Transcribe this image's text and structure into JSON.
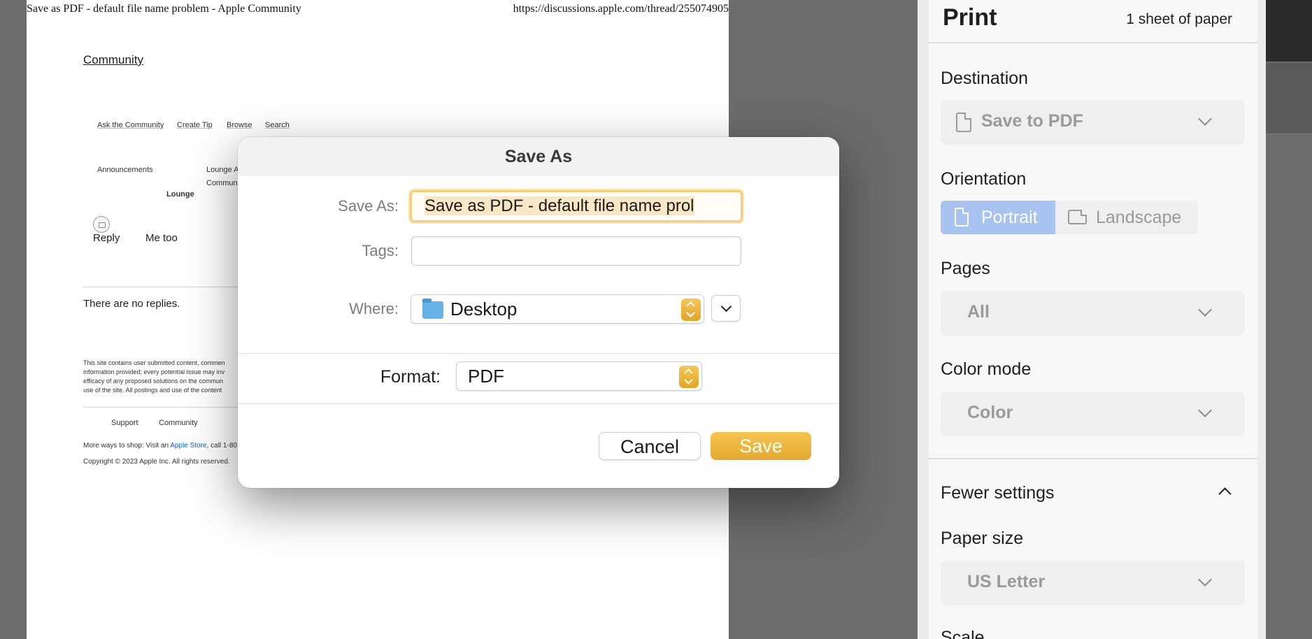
{
  "preview": {
    "header_title": "Save as PDF - default file name problem - Apple Community",
    "header_url": "https://discussions.apple.com/thread/255074905",
    "community_link": "Community",
    "nav": [
      "Ask the Community",
      "Create Tip",
      "Browse",
      "Search"
    ],
    "breadcrumb_announcements": "Announcements",
    "breadcrumb_lounge_a": "Lounge A",
    "breadcrumb_communi": "Communi",
    "breadcrumb_lounge": "Lounge",
    "reply_label": "Reply",
    "me_too_label": "Me too",
    "no_replies": "There are no replies.",
    "disclaimer_lines": [
      "This site contains user submitted content, commen",
      "information provided; every potential issue may inv",
      "efficacy of any proposed solutions on the commun",
      "use of the site. All postings and use of the content"
    ],
    "footer_support": "Support",
    "footer_community": "Community",
    "shop_prefix": "More ways to shop: Visit an ",
    "shop_link": "Apple Store",
    "shop_suffix": ", call 1-80",
    "copyright": "Copyright © 2023 Apple Inc. All rights reserved."
  },
  "print_panel": {
    "title": "Print",
    "sheets": "1 sheet of paper",
    "destination_label": "Destination",
    "destination_value": "Save to PDF",
    "orientation_label": "Orientation",
    "orientation_portrait": "Portrait",
    "orientation_landscape": "Landscape",
    "orientation_selected": "Portrait",
    "pages_label": "Pages",
    "pages_value": "All",
    "color_mode_label": "Color mode",
    "color_mode_value": "Color",
    "fewer_settings": "Fewer settings",
    "paper_size_label": "Paper size",
    "paper_size_value": "US Letter",
    "scale_label": "Scale"
  },
  "dialog": {
    "title": "Save As",
    "save_as_label": "Save As:",
    "save_as_value": "Save as PDF - default file name prol",
    "tags_label": "Tags:",
    "tags_value": "",
    "where_label": "Where:",
    "where_value": "Desktop",
    "format_label": "Format:",
    "format_value": "PDF",
    "cancel_label": "Cancel",
    "save_label": "Save"
  },
  "colors": {
    "accent": "#e5a92e",
    "portrait_selected": "#a8c3f0",
    "focus_ring": "#f5cf7e"
  }
}
